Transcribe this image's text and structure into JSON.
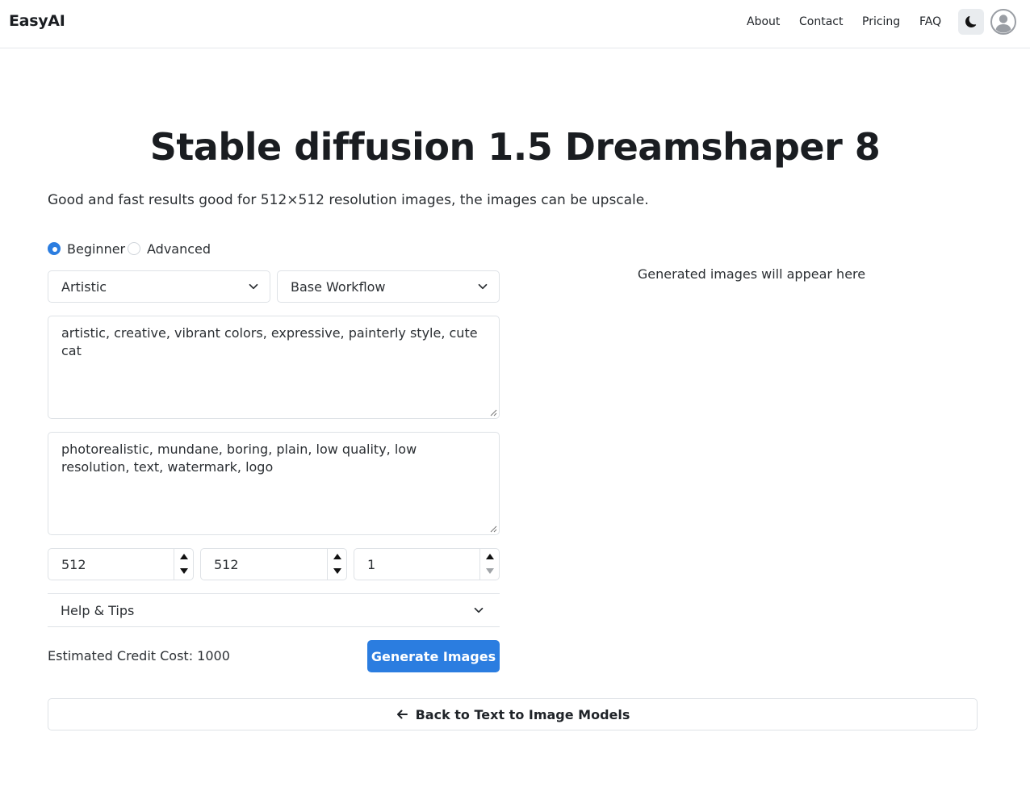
{
  "brand": "EasyAI",
  "nav": {
    "links": [
      "About",
      "Contact",
      "Pricing",
      "FAQ"
    ],
    "theme_icon": "moon-icon",
    "avatar_icon": "user-avatar-icon"
  },
  "page": {
    "title": "Stable diffusion 1.5 Dreamshaper 8",
    "description": "Good and fast results good for 512×512 resolution images, the images can be upscale."
  },
  "mode": {
    "options": [
      "Beginner",
      "Advanced"
    ],
    "selected": "Beginner"
  },
  "form": {
    "style_select": "Artistic",
    "workflow_select": "Base Workflow",
    "positive_prompt": "artistic, creative, vibrant colors, expressive, painterly style, cute cat",
    "negative_prompt": "photorealistic, mundane, boring, plain, low quality, low resolution, text, watermark, logo",
    "width": "512",
    "height": "512",
    "count": "1",
    "help_label": "Help & Tips",
    "cost_label": "Estimated Credit Cost: 1000",
    "generate_label": "Generate Images"
  },
  "results": {
    "placeholder": "Generated images will appear here"
  },
  "back_label": "Back to Text to Image Models",
  "colors": {
    "accent": "#2b7de0",
    "border": "#dee2e6",
    "text": "#2b2f33"
  }
}
